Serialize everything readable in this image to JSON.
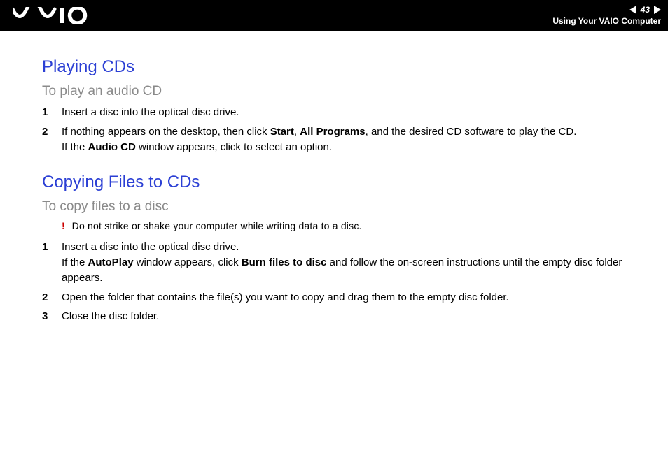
{
  "header": {
    "page_number": "43",
    "section_title": "Using Your VAIO Computer"
  },
  "section1": {
    "heading": "Playing CDs",
    "subheading": "To play an audio CD",
    "steps": [
      {
        "num": "1",
        "text_plain": "Insert a disc into the optical disc drive."
      },
      {
        "num": "2",
        "line1_pre": "If nothing appears on the desktop, then click ",
        "b1": "Start",
        "sep1": ", ",
        "b2": "All Programs",
        "line1_post": ", and the desired CD software to play the CD.",
        "line2_pre": "If the ",
        "b3": "Audio CD",
        "line2_post": " window appears, click to select an option."
      }
    ]
  },
  "section2": {
    "heading": "Copying Files to CDs",
    "subheading": "To copy files to a disc",
    "warning_mark": "!",
    "warning_text": "Do not strike or shake your computer while writing data to a disc.",
    "steps": [
      {
        "num": "1",
        "line1": "Insert a disc into the optical disc drive.",
        "line2_pre": "If the ",
        "b1": "AutoPlay",
        "line2_mid": " window appears, click ",
        "b2": "Burn files to disc",
        "line2_post": " and follow the on-screen instructions until the empty disc folder appears."
      },
      {
        "num": "2",
        "text_plain": "Open the folder that contains the file(s) you want to copy and drag them to the empty disc folder."
      },
      {
        "num": "3",
        "text_plain": "Close the disc folder."
      }
    ]
  }
}
